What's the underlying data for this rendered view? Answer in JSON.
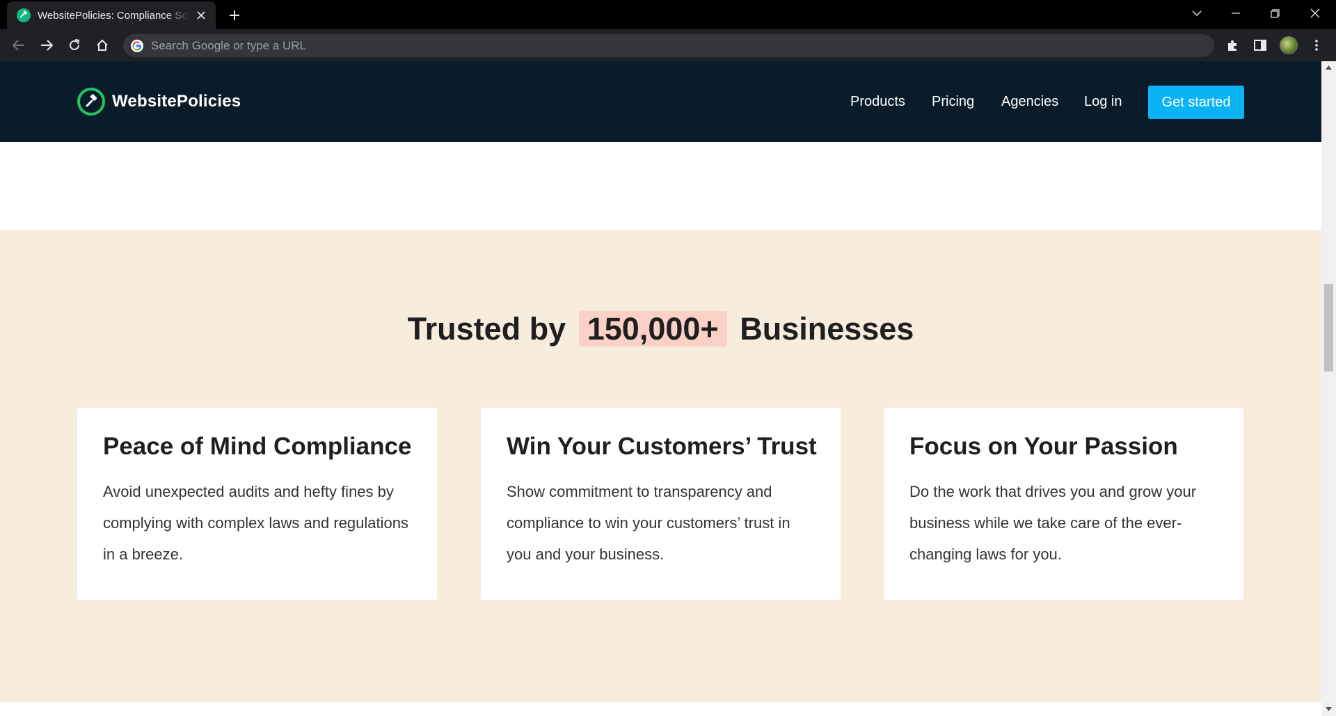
{
  "browser": {
    "tab_title": "WebsitePolicies: Compliance Solutions",
    "omnibox_placeholder": "Search Google or type a URL"
  },
  "header": {
    "logo_text": "WebsitePolicies",
    "nav": [
      {
        "label": "Products"
      },
      {
        "label": "Pricing"
      },
      {
        "label": "Agencies"
      },
      {
        "label": "Log in"
      }
    ],
    "cta_label": "Get started"
  },
  "trust": {
    "headline_prefix": "Trusted by",
    "headline_highlight": "150,000+",
    "headline_suffix": "Businesses",
    "cards": [
      {
        "title": "Peace of Mind Compliance",
        "text": "Avoid unexpected audits and hefty fines by complying with complex laws and regulations in a breeze."
      },
      {
        "title": "Win Your Customers’ Trust",
        "text": "Show commitment to transparency and compliance to win your customers’ trust in you and your business."
      },
      {
        "title": "Focus on Your Passion",
        "text": "Do the work that drives you and grow your business while we take care of the ever-changing laws for you."
      }
    ]
  },
  "colors": {
    "header_bg": "#0a1c2a",
    "cta_bg": "#0ab4f4",
    "section_bg": "#f8ecdd",
    "highlight_bg": "#fbd1c7",
    "logo_accent": "#22c55e"
  },
  "icons": [
    "gavel-icon",
    "close-icon",
    "plus-icon",
    "back-icon",
    "forward-icon",
    "reload-icon",
    "home-icon",
    "google-icon",
    "extensions-icon",
    "side-panel-icon",
    "menu-icon"
  ]
}
